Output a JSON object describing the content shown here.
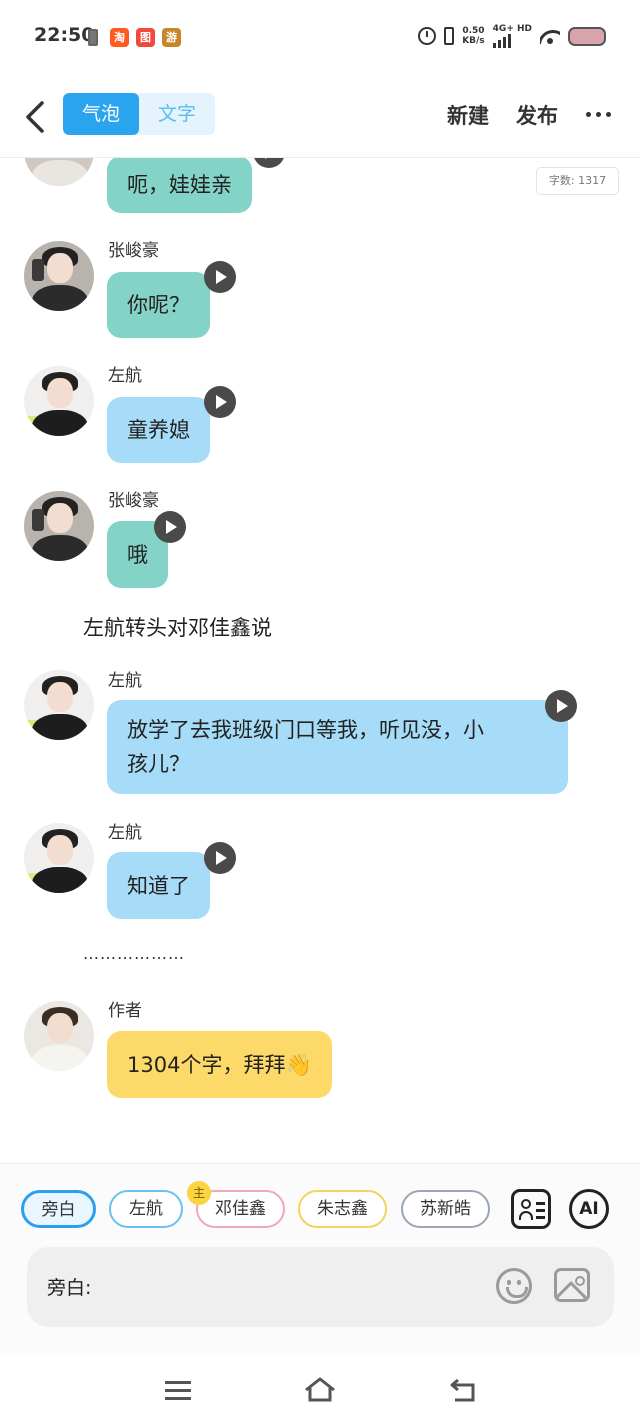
{
  "status_bar": {
    "time": "22:50",
    "app_icons": [
      {
        "label": "淘",
        "icon": "taobao-app-icon",
        "color": "#ff5a1f"
      },
      {
        "label": "图",
        "icon": "app-icon",
        "color": "#f14a3b"
      },
      {
        "label": "游",
        "icon": "game-app-icon",
        "color": "#c7862c"
      }
    ],
    "net_speed_value": "0.50",
    "net_speed_unit": "KB/s",
    "network": "4G+ HD"
  },
  "header": {
    "tabs": [
      {
        "label": "气泡",
        "active": true
      },
      {
        "label": "文字",
        "active": false
      }
    ],
    "new_label": "新建",
    "publish_label": "发布"
  },
  "word_count": "字数: 1317",
  "messages": [
    {
      "speaker": "",
      "text": "呃，娃娃亲",
      "color": "teal",
      "voice": true
    },
    {
      "speaker": "张峻豪",
      "text": "你呢？",
      "color": "teal",
      "voice": true
    },
    {
      "speaker": "左航",
      "text": "童养媳",
      "color": "blue",
      "voice": true
    },
    {
      "speaker": "张峻豪",
      "text": "哦",
      "color": "teal",
      "voice": true
    },
    {
      "narration": "左航转头对邓佳鑫说"
    },
    {
      "speaker": "左航",
      "text_lines": [
        "放学了去我班级门口等我，听见没，小",
        "孩儿？"
      ],
      "color": "blue",
      "voice": true
    },
    {
      "speaker": "左航",
      "text": "知道了",
      "color": "blue",
      "voice": true
    },
    {
      "narration": "………………"
    },
    {
      "speaker": "作者",
      "text": "1304个字，拜拜👋",
      "color": "yellow",
      "voice": false
    }
  ],
  "characters": [
    {
      "label": "旁白",
      "selected": true,
      "border": "#2a9ff0"
    },
    {
      "label": "左航",
      "selected": false,
      "border": "#6cc0f0"
    },
    {
      "label": "邓佳鑫",
      "selected": false,
      "border": "#f2a7b6",
      "badge": "主"
    },
    {
      "label": "朱志鑫",
      "selected": false,
      "border": "#f2d45a"
    },
    {
      "label": "苏新皓",
      "selected": false,
      "border": "#9aa6b2"
    }
  ],
  "ai_label": "AI",
  "input": {
    "label": "旁白:"
  },
  "colors": {
    "accent": "#2aa4ef",
    "teal_bubble": "#84d3c7",
    "blue_bubble": "#a6dcf7",
    "yellow_bubble": "#fdd969"
  }
}
